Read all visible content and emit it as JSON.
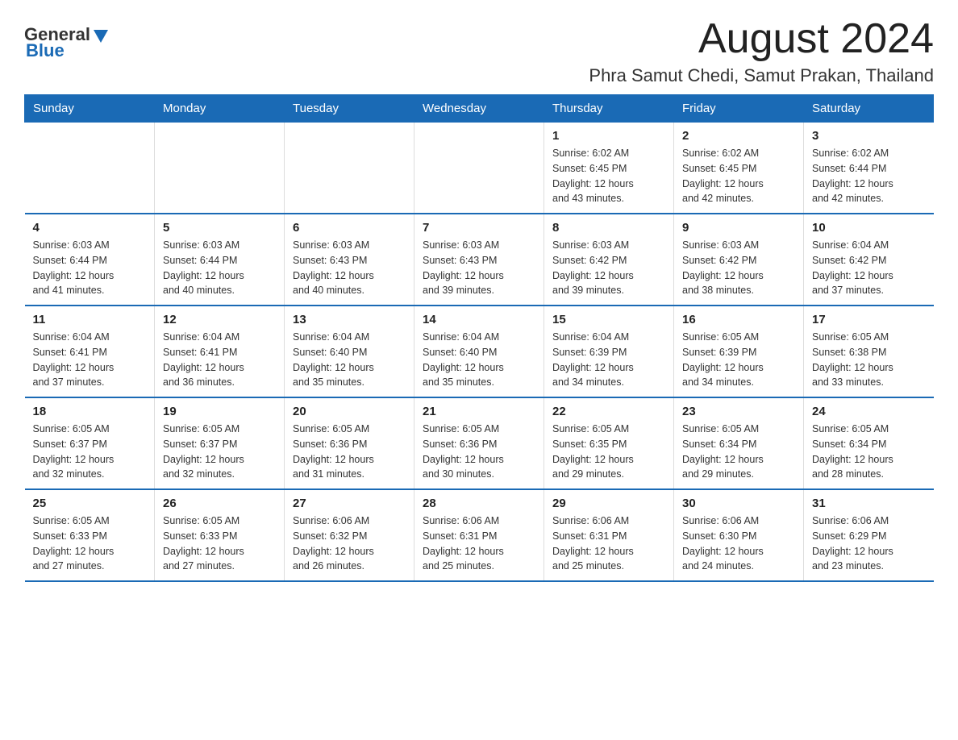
{
  "header": {
    "logo_general": "General",
    "logo_blue": "Blue",
    "month_title": "August 2024",
    "location": "Phra Samut Chedi, Samut Prakan, Thailand"
  },
  "days_of_week": [
    "Sunday",
    "Monday",
    "Tuesday",
    "Wednesday",
    "Thursday",
    "Friday",
    "Saturday"
  ],
  "weeks": [
    [
      {
        "day": "",
        "info": ""
      },
      {
        "day": "",
        "info": ""
      },
      {
        "day": "",
        "info": ""
      },
      {
        "day": "",
        "info": ""
      },
      {
        "day": "1",
        "info": "Sunrise: 6:02 AM\nSunset: 6:45 PM\nDaylight: 12 hours\nand 43 minutes."
      },
      {
        "day": "2",
        "info": "Sunrise: 6:02 AM\nSunset: 6:45 PM\nDaylight: 12 hours\nand 42 minutes."
      },
      {
        "day": "3",
        "info": "Sunrise: 6:02 AM\nSunset: 6:44 PM\nDaylight: 12 hours\nand 42 minutes."
      }
    ],
    [
      {
        "day": "4",
        "info": "Sunrise: 6:03 AM\nSunset: 6:44 PM\nDaylight: 12 hours\nand 41 minutes."
      },
      {
        "day": "5",
        "info": "Sunrise: 6:03 AM\nSunset: 6:44 PM\nDaylight: 12 hours\nand 40 minutes."
      },
      {
        "day": "6",
        "info": "Sunrise: 6:03 AM\nSunset: 6:43 PM\nDaylight: 12 hours\nand 40 minutes."
      },
      {
        "day": "7",
        "info": "Sunrise: 6:03 AM\nSunset: 6:43 PM\nDaylight: 12 hours\nand 39 minutes."
      },
      {
        "day": "8",
        "info": "Sunrise: 6:03 AM\nSunset: 6:42 PM\nDaylight: 12 hours\nand 39 minutes."
      },
      {
        "day": "9",
        "info": "Sunrise: 6:03 AM\nSunset: 6:42 PM\nDaylight: 12 hours\nand 38 minutes."
      },
      {
        "day": "10",
        "info": "Sunrise: 6:04 AM\nSunset: 6:42 PM\nDaylight: 12 hours\nand 37 minutes."
      }
    ],
    [
      {
        "day": "11",
        "info": "Sunrise: 6:04 AM\nSunset: 6:41 PM\nDaylight: 12 hours\nand 37 minutes."
      },
      {
        "day": "12",
        "info": "Sunrise: 6:04 AM\nSunset: 6:41 PM\nDaylight: 12 hours\nand 36 minutes."
      },
      {
        "day": "13",
        "info": "Sunrise: 6:04 AM\nSunset: 6:40 PM\nDaylight: 12 hours\nand 35 minutes."
      },
      {
        "day": "14",
        "info": "Sunrise: 6:04 AM\nSunset: 6:40 PM\nDaylight: 12 hours\nand 35 minutes."
      },
      {
        "day": "15",
        "info": "Sunrise: 6:04 AM\nSunset: 6:39 PM\nDaylight: 12 hours\nand 34 minutes."
      },
      {
        "day": "16",
        "info": "Sunrise: 6:05 AM\nSunset: 6:39 PM\nDaylight: 12 hours\nand 34 minutes."
      },
      {
        "day": "17",
        "info": "Sunrise: 6:05 AM\nSunset: 6:38 PM\nDaylight: 12 hours\nand 33 minutes."
      }
    ],
    [
      {
        "day": "18",
        "info": "Sunrise: 6:05 AM\nSunset: 6:37 PM\nDaylight: 12 hours\nand 32 minutes."
      },
      {
        "day": "19",
        "info": "Sunrise: 6:05 AM\nSunset: 6:37 PM\nDaylight: 12 hours\nand 32 minutes."
      },
      {
        "day": "20",
        "info": "Sunrise: 6:05 AM\nSunset: 6:36 PM\nDaylight: 12 hours\nand 31 minutes."
      },
      {
        "day": "21",
        "info": "Sunrise: 6:05 AM\nSunset: 6:36 PM\nDaylight: 12 hours\nand 30 minutes."
      },
      {
        "day": "22",
        "info": "Sunrise: 6:05 AM\nSunset: 6:35 PM\nDaylight: 12 hours\nand 29 minutes."
      },
      {
        "day": "23",
        "info": "Sunrise: 6:05 AM\nSunset: 6:34 PM\nDaylight: 12 hours\nand 29 minutes."
      },
      {
        "day": "24",
        "info": "Sunrise: 6:05 AM\nSunset: 6:34 PM\nDaylight: 12 hours\nand 28 minutes."
      }
    ],
    [
      {
        "day": "25",
        "info": "Sunrise: 6:05 AM\nSunset: 6:33 PM\nDaylight: 12 hours\nand 27 minutes."
      },
      {
        "day": "26",
        "info": "Sunrise: 6:05 AM\nSunset: 6:33 PM\nDaylight: 12 hours\nand 27 minutes."
      },
      {
        "day": "27",
        "info": "Sunrise: 6:06 AM\nSunset: 6:32 PM\nDaylight: 12 hours\nand 26 minutes."
      },
      {
        "day": "28",
        "info": "Sunrise: 6:06 AM\nSunset: 6:31 PM\nDaylight: 12 hours\nand 25 minutes."
      },
      {
        "day": "29",
        "info": "Sunrise: 6:06 AM\nSunset: 6:31 PM\nDaylight: 12 hours\nand 25 minutes."
      },
      {
        "day": "30",
        "info": "Sunrise: 6:06 AM\nSunset: 6:30 PM\nDaylight: 12 hours\nand 24 minutes."
      },
      {
        "day": "31",
        "info": "Sunrise: 6:06 AM\nSunset: 6:29 PM\nDaylight: 12 hours\nand 23 minutes."
      }
    ]
  ]
}
